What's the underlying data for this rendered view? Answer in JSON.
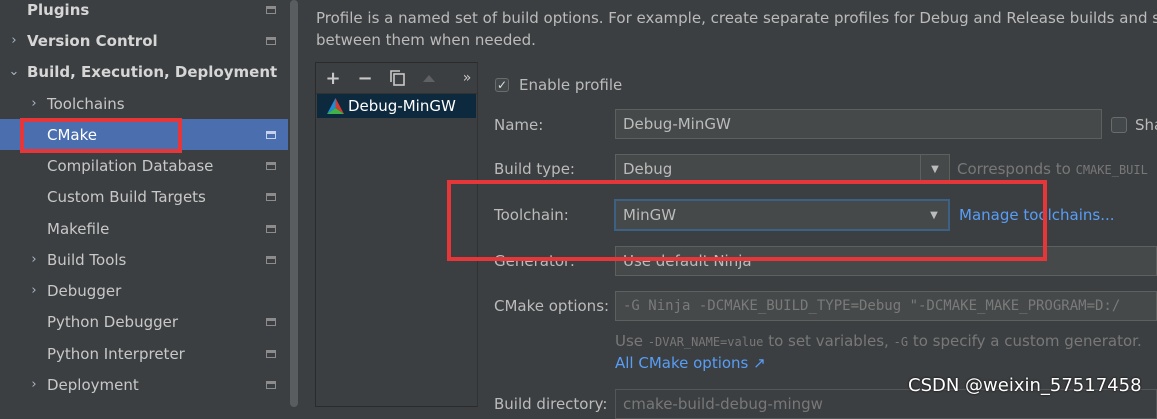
{
  "sidebar": {
    "items": [
      {
        "label": "Plugins"
      },
      {
        "label": "Version Control"
      },
      {
        "label": "Build, Execution, Deployment"
      },
      {
        "label": "Toolchains"
      },
      {
        "label": "CMake"
      },
      {
        "label": "Compilation Database"
      },
      {
        "label": "Custom Build Targets"
      },
      {
        "label": "Makefile"
      },
      {
        "label": "Build Tools"
      },
      {
        "label": "Debugger"
      },
      {
        "label": "Python Debugger"
      },
      {
        "label": "Python Interpreter"
      },
      {
        "label": "Deployment"
      }
    ],
    "selected": "CMake"
  },
  "description": {
    "line1": "Profile is a named set of build options. For example, create separate profiles for Debug and Release builds and switch",
    "line2": "between them when needed."
  },
  "profiles": {
    "toolbar": {
      "add": "+",
      "remove": "−",
      "copy_icon": "copy-icon",
      "up_icon": "arrow-up-icon",
      "more": "»"
    },
    "items": [
      {
        "label": "Debug-MinGW"
      }
    ]
  },
  "form": {
    "enable_profile": {
      "label": "Enable profile",
      "checked": true
    },
    "name": {
      "label": "Name:",
      "value": "Debug-MinGW"
    },
    "shared": {
      "label": "Sha",
      "checked": false
    },
    "build_type": {
      "label": "Build type:",
      "value": "Debug",
      "hint": "Corresponds to",
      "hint_code": "CMAKE_BUIL"
    },
    "toolchain": {
      "label": "Toolchain:",
      "value": "MinGW",
      "link": "Manage toolchains..."
    },
    "generator": {
      "label": "Generator:",
      "value": "Use default  Ninja"
    },
    "cmake_options": {
      "label": "CMake options:",
      "value": "-G Ninja -DCMAKE_BUILD_TYPE=Debug \"-DCMAKE_MAKE_PROGRAM=D:/",
      "hint_use": "Use",
      "hint_var": "-DVAR_NAME=value",
      "hint_mid": "to set variables,",
      "hint_g": "-G",
      "hint_end": "to specify a custom generator.",
      "link": "All CMake options ↗"
    },
    "build_directory": {
      "label": "Build directory:",
      "value": "cmake-build-debug-mingw"
    }
  },
  "watermark": "CSDN @weixin_57517458",
  "colors": {
    "selection": "#4b6eaf",
    "highlight": "#e5373a",
    "link": "#589df6",
    "background": "#3c3f41"
  }
}
